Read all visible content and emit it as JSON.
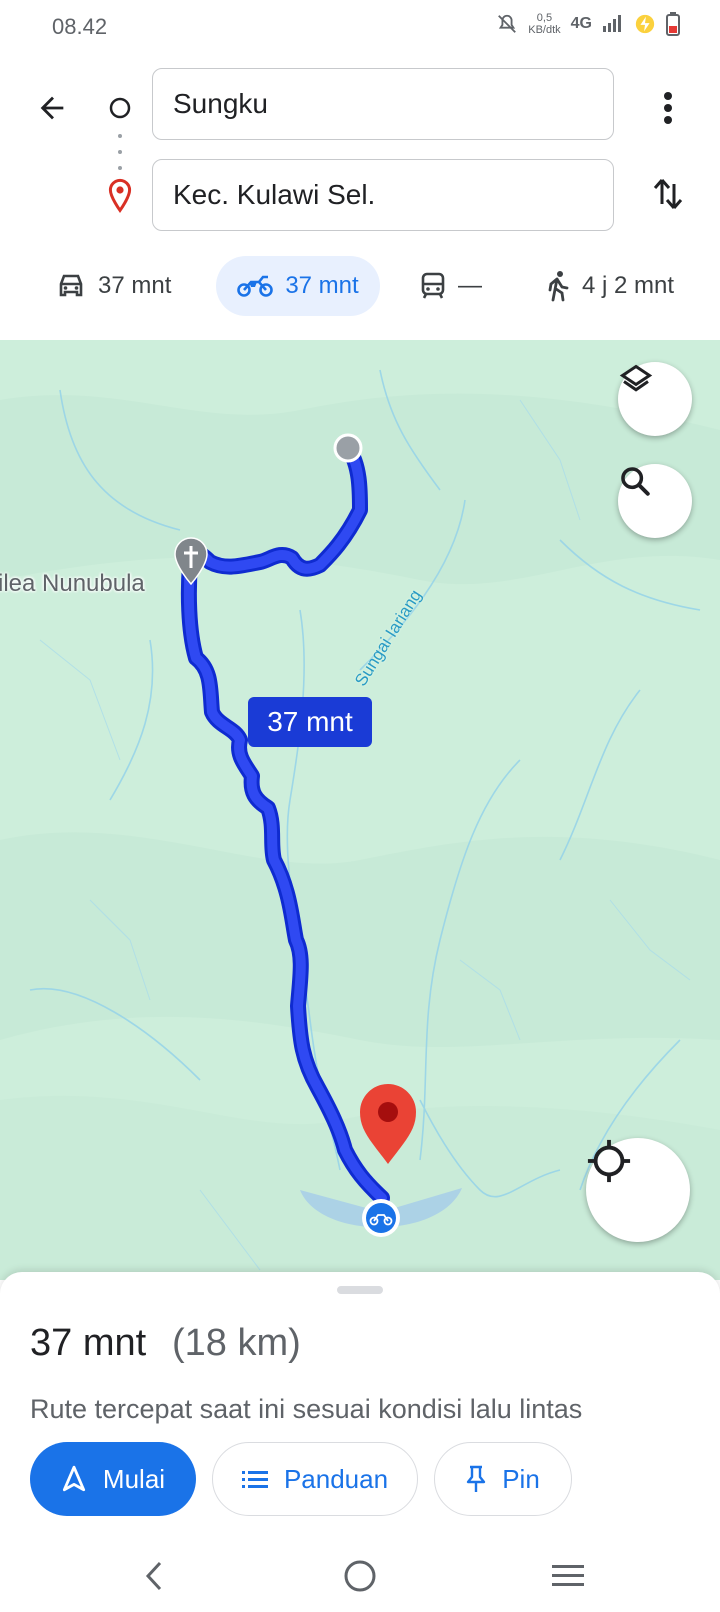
{
  "status_bar": {
    "time": "08.42",
    "speed_value": "0,5",
    "speed_unit": "KB/dtk",
    "network": "4G"
  },
  "directions": {
    "origin": "Sungku",
    "destination": "Kec. Kulawi Sel."
  },
  "modes": [
    {
      "name": "car-icon",
      "label": "37 mnt",
      "selected": false
    },
    {
      "name": "motorcycle-icon",
      "label": "37 mnt",
      "selected": true
    },
    {
      "name": "transit-icon",
      "label": "—",
      "selected": false
    },
    {
      "name": "walk-icon",
      "label": "4 j 2 mnt",
      "selected": false
    }
  ],
  "map": {
    "route_time_chip": "37 mnt",
    "place_label": "ilea Nunubula",
    "river_label": "Sungai Iariang",
    "route_color": "#1a3bd6",
    "destination_marker_color": "#ea4335"
  },
  "sheet": {
    "duration": "37 mnt",
    "distance": "(18 km)",
    "subtitle": "Rute tercepat saat ini sesuai kondisi lalu lintas",
    "buttons": {
      "start": "Mulai",
      "guide": "Panduan",
      "pin": "Pin"
    }
  },
  "colors": {
    "accent": "#1a73e8",
    "map_background": "#cdeedb"
  }
}
